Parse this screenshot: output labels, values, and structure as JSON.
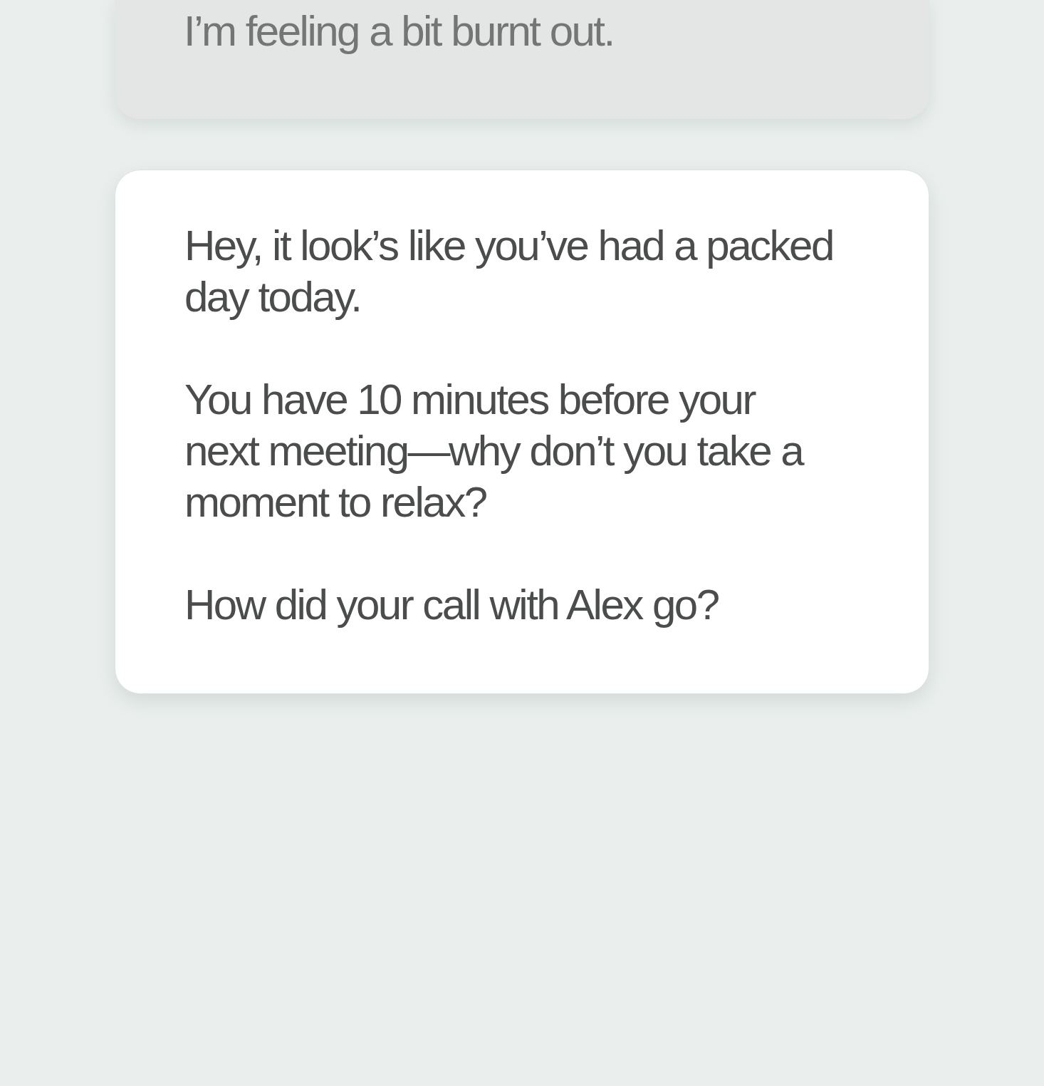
{
  "conversation": {
    "messages": [
      {
        "kind": "sent",
        "paragraphs": [
          "I’m feeling a bit burnt out."
        ]
      },
      {
        "kind": "reply",
        "paragraphs": [
          "Hey, it look’s like you’ve had a packed day today.",
          "You have 10 minutes before your next meeting—why don’t you take a moment to relax?",
          "How did your call with Alex go?"
        ]
      }
    ]
  }
}
